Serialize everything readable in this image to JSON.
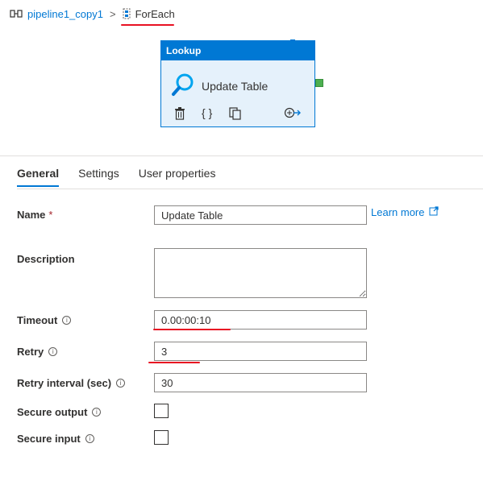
{
  "breadcrumb": {
    "pipeline_label": "pipeline1_copy1",
    "separator": ">",
    "current_label": "ForEach"
  },
  "activity_card": {
    "header": "Lookup",
    "name": "Update Table",
    "actions": [
      "delete-icon",
      "code-icon",
      "copy-icon",
      "add-output-icon"
    ]
  },
  "tabs": [
    {
      "label": "General",
      "active": true
    },
    {
      "label": "Settings",
      "active": false
    },
    {
      "label": "User properties",
      "active": false
    }
  ],
  "form": {
    "name": {
      "label": "Name",
      "required_mark": "*",
      "value": "Update Table"
    },
    "learn_more": "Learn more",
    "description": {
      "label": "Description",
      "value": ""
    },
    "timeout": {
      "label": "Timeout",
      "value": "0.00:00:10"
    },
    "retry": {
      "label": "Retry",
      "value": "3"
    },
    "retry_interval": {
      "label": "Retry interval (sec)",
      "value": "30"
    },
    "secure_output": {
      "label": "Secure output",
      "checked": false
    },
    "secure_input": {
      "label": "Secure input",
      "checked": false
    }
  },
  "colors": {
    "accent": "#0078d4",
    "annotation_red": "#e81123",
    "card_background": "#e5f1fb",
    "port_green": "#4caf50"
  }
}
